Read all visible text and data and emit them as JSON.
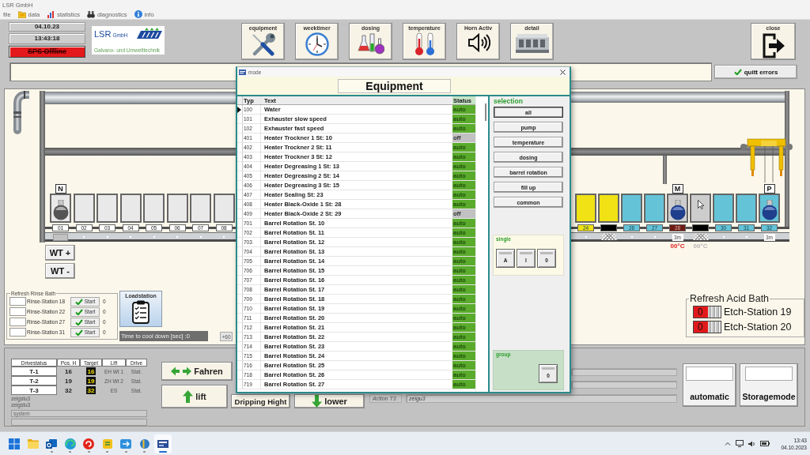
{
  "app": {
    "title": "LSR GmbH"
  },
  "menu": [
    {
      "label": "file"
    },
    {
      "label": "data"
    },
    {
      "label": "statistics"
    },
    {
      "label": "diagnostics"
    },
    {
      "label": "info"
    }
  ],
  "status": {
    "date": "04.10.23",
    "time": "13:43:18",
    "plc": "SPS Offline",
    "plc_online": false
  },
  "logo": {
    "name": "LSR",
    "suffix": "GmbH",
    "tagline": "Galvano- und Umwelttechnik"
  },
  "toolbar": [
    {
      "label": "equipment"
    },
    {
      "label": "weektimer"
    },
    {
      "label": "dosing"
    },
    {
      "label": "temperature"
    },
    {
      "label": "Horn Activ"
    },
    {
      "label": "detail"
    }
  ],
  "close_button": {
    "label": "close"
  },
  "message_bar": {
    "button": "quitt errors"
  },
  "plant": {
    "tanks_left": [
      {
        "label": {
          "text": "01"
        },
        "marker": "N",
        "rail": {
          "kind": "carrier"
        }
      },
      {
        "label": {
          "text": "02"
        },
        "rail": {
          "kind": "dot"
        }
      },
      {
        "label": {
          "text": "03"
        },
        "rail": {
          "kind": "dot"
        }
      },
      {
        "label": {
          "text": "04"
        },
        "rail": {
          "kind": "dot"
        }
      },
      {
        "label": {
          "text": "05"
        },
        "rail": {
          "kind": "dot"
        }
      },
      {
        "label": {
          "text": "06"
        },
        "rail": {
          "kind": "dot"
        }
      },
      {
        "label": {
          "text": "07"
        },
        "rail": {
          "kind": "dot"
        }
      },
      {
        "label": {
          "text": "08"
        },
        "rail": {
          "kind": "dot"
        }
      }
    ],
    "tanks_right": [
      {
        "color": "#f0e214",
        "label": {
          "text": "24",
          "color": "#f0e214"
        },
        "rail": {
          "kind": "dot"
        }
      },
      {
        "color": "#f0e214",
        "label": {
          "color": "#000000"
        },
        "rail": {
          "kind": "hatch"
        }
      },
      {
        "color": "#64c3d7",
        "label": {
          "text": "26",
          "color": "#64c3d7"
        },
        "rail": {
          "kind": "dot"
        }
      },
      {
        "color": "#64c3d7",
        "label": {
          "text": "27",
          "color": "#64c3d7"
        },
        "rail": {
          "kind": "dot"
        }
      },
      {
        "marker": "M",
        "color": "#cdcdcd",
        "label": {
          "text": "28",
          "color": "#6e1a12"
        },
        "rail": {
          "kind": "tag",
          "text": "3m"
        },
        "temperature": {
          "text": "00°C",
          "alarm": true
        }
      },
      {
        "color": "#cdcdcd",
        "label": {
          "color": "#000000"
        },
        "rail": {
          "kind": "hatch"
        },
        "temperature": {
          "text": "00°C",
          "alarm": false
        }
      },
      {
        "color": "#64c3d7",
        "label": {
          "text": "30",
          "color": "#64c3d7"
        },
        "rail": {
          "kind": "dot"
        }
      },
      {
        "color": "#64c3d7",
        "label": {
          "text": "31",
          "color": "#64c3d7"
        },
        "rail": {
          "kind": "dot"
        }
      },
      {
        "marker": "P",
        "color": "#64c3d7",
        "label": {
          "text": "32",
          "color": "#64c3d7"
        },
        "rail": {
          "kind": "tag",
          "text": "3m"
        }
      }
    ],
    "wt_buttons": [
      "WT +",
      "WT -"
    ]
  },
  "rinse_refresh": {
    "title": "Refresh Rinse Bath",
    "rows": [
      {
        "station": "Rinse-Station 18",
        "button": "Start",
        "count": "0"
      },
      {
        "station": "Rinse-Station 22",
        "button": "Start",
        "count": "0"
      },
      {
        "station": "Rinse-Station 27",
        "button": "Start",
        "count": "0"
      },
      {
        "station": "Rinse-Station 31",
        "button": "Start",
        "count": "0"
      }
    ]
  },
  "loadstation": {
    "label": "Loadstation"
  },
  "cooldown": {
    "text": "Time to cool down [sec] :0",
    "button": "+60"
  },
  "acid_refresh": {
    "title": "Refresh Acid Bath",
    "rows": [
      {
        "switch": "0",
        "station": "Etch-Station 19",
        "on": false
      },
      {
        "switch": "0",
        "station": "Etch-Station 20",
        "on": false
      }
    ]
  },
  "drive_status": {
    "columns": [
      "Drivestatus",
      "Pos. H",
      "Target",
      "Lift",
      "Drive"
    ],
    "rows": [
      [
        "T-1",
        "16",
        "16",
        "EH Wt 1",
        "Stat."
      ],
      [
        "T-2",
        "19",
        "19",
        "ZH Wt 2",
        "Stat."
      ],
      [
        "T-3",
        "32",
        "32",
        "ES",
        "Stat."
      ]
    ]
  },
  "log": [
    "zeigstu3",
    "zeigstu3"
  ],
  "system": "system",
  "drive_buttons": [
    {
      "label": "Fahren"
    },
    {
      "label": "lift"
    },
    {
      "label": "Dripping Hight"
    },
    {
      "label": "lower"
    }
  ],
  "action": {
    "label": "Action T3",
    "value": "zeigu3"
  },
  "mode_buttons": [
    {
      "label": "automatic"
    },
    {
      "label": "Storagemode"
    }
  ],
  "dialog": {
    "title": "mode",
    "heading": "Equipment",
    "columns": [
      "Typ",
      "Text",
      "Status"
    ],
    "rows": [
      {
        "typ": "100",
        "text": "Water",
        "status": "auto",
        "active": true,
        "selected": true
      },
      {
        "typ": "101",
        "text": "Exhauster slow speed",
        "status": "auto",
        "active": true,
        "selected": false
      },
      {
        "typ": "102",
        "text": "Exhauster fast speed",
        "status": "auto",
        "active": true,
        "selected": false
      },
      {
        "typ": "401",
        "text": "Heater Trockner 1 St: 10",
        "status": "off",
        "active": false,
        "selected": false
      },
      {
        "typ": "402",
        "text": "Heater Trockner 2 St: 11",
        "status": "auto",
        "active": true,
        "selected": false
      },
      {
        "typ": "403",
        "text": "Heater Trockner 3 St: 12",
        "status": "auto",
        "active": true,
        "selected": false
      },
      {
        "typ": "404",
        "text": "Heater Degreasing 1 St: 13",
        "status": "auto",
        "active": true,
        "selected": false
      },
      {
        "typ": "405",
        "text": "Heater Degreasing 2 St: 14",
        "status": "auto",
        "active": true,
        "selected": false
      },
      {
        "typ": "406",
        "text": "Heater Degreasing 3 St: 15",
        "status": "auto",
        "active": true,
        "selected": false
      },
      {
        "typ": "407",
        "text": "Heater Sealing St: 23",
        "status": "auto",
        "active": true,
        "selected": false
      },
      {
        "typ": "408",
        "text": "Heater Black-Oxide 1 St: 28",
        "status": "auto",
        "active": true,
        "selected": false
      },
      {
        "typ": "409",
        "text": "Heater Black-Oxide 2 St: 29",
        "status": "off",
        "active": false,
        "selected": false
      },
      {
        "typ": "701",
        "text": "Barrel Rotation St. 10",
        "status": "auto",
        "active": true,
        "selected": false
      },
      {
        "typ": "702",
        "text": "Barrel Rotation St. 11",
        "status": "auto",
        "active": true,
        "selected": false
      },
      {
        "typ": "703",
        "text": "Barrel Rotation St. 12",
        "status": "auto",
        "active": true,
        "selected": false
      },
      {
        "typ": "704",
        "text": "Barrel Rotation St. 13",
        "status": "auto",
        "active": true,
        "selected": false
      },
      {
        "typ": "705",
        "text": "Barrel Rotation St. 14",
        "status": "auto",
        "active": true,
        "selected": false
      },
      {
        "typ": "706",
        "text": "Barrel Rotation St. 15",
        "status": "auto",
        "active": true,
        "selected": false
      },
      {
        "typ": "707",
        "text": "Barrel Rotation St. 16",
        "status": "auto",
        "active": true,
        "selected": false
      },
      {
        "typ": "708",
        "text": "Barrel Rotation St. 17",
        "status": "auto",
        "active": true,
        "selected": false
      },
      {
        "typ": "709",
        "text": "Barrel Rotation St. 18",
        "status": "auto",
        "active": true,
        "selected": false
      },
      {
        "typ": "710",
        "text": "Barrel Rotation St. 19",
        "status": "auto",
        "active": true,
        "selected": false
      },
      {
        "typ": "711",
        "text": "Barrel Rotation St. 20",
        "status": "auto",
        "active": true,
        "selected": false
      },
      {
        "typ": "712",
        "text": "Barrel Rotation St. 21",
        "status": "auto",
        "active": true,
        "selected": false
      },
      {
        "typ": "713",
        "text": "Barrel Rotation St. 22",
        "status": "auto",
        "active": true,
        "selected": false
      },
      {
        "typ": "714",
        "text": "Barrel Rotation St. 23",
        "status": "auto",
        "active": true,
        "selected": false
      },
      {
        "typ": "715",
        "text": "Barrel Rotation St. 24",
        "status": "auto",
        "active": true,
        "selected": false
      },
      {
        "typ": "716",
        "text": "Barrel Rotation St. 25",
        "status": "auto",
        "active": true,
        "selected": false
      },
      {
        "typ": "718",
        "text": "Barrel Rotation St. 26",
        "status": "auto",
        "active": true,
        "selected": false
      },
      {
        "typ": "719",
        "text": "Barrel Rotation St. 27",
        "status": "auto",
        "active": true,
        "selected": false
      }
    ],
    "selection": {
      "title": "selection",
      "buttons": [
        {
          "label": "all",
          "selected": true
        },
        {
          "label": "pump",
          "selected": false
        },
        {
          "label": "temperature",
          "selected": false
        },
        {
          "label": "dosing",
          "selected": false
        },
        {
          "label": "barrel rotation",
          "selected": false
        },
        {
          "label": "fill up",
          "selected": false
        },
        {
          "label": "common",
          "selected": false
        }
      ]
    },
    "single": {
      "title": "single",
      "switches": [
        "A",
        "I",
        "0"
      ]
    },
    "group": {
      "title": "group",
      "switches": [
        "0"
      ]
    }
  },
  "taskbar": {
    "apps": [
      {
        "running": false,
        "active": false
      },
      {
        "running": false,
        "active": false
      },
      {
        "running": true,
        "active": false
      },
      {
        "running": true,
        "active": false
      },
      {
        "running": true,
        "active": false
      },
      {
        "running": true,
        "active": false
      },
      {
        "running": true,
        "active": false
      },
      {
        "running": true,
        "active": false
      },
      {
        "running": true,
        "active": true
      }
    ],
    "time": "13:43",
    "date": "04.10.2023"
  }
}
